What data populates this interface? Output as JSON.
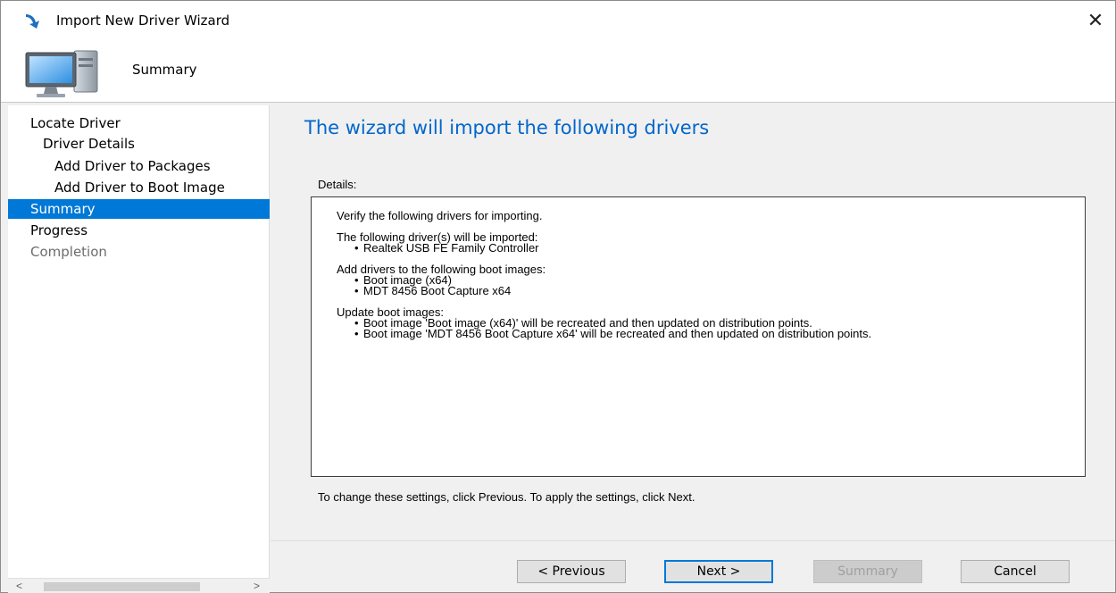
{
  "window": {
    "title": "Import New Driver Wizard",
    "close_glyph": "✕"
  },
  "header": {
    "title": "Summary",
    "icon": "computer-icon"
  },
  "nav": {
    "items": [
      {
        "label": "Locate Driver",
        "state": "normal"
      },
      {
        "label": "Driver Details",
        "state": "normal"
      },
      {
        "label": "Add Driver to Packages",
        "state": "normal"
      },
      {
        "label": "Add Driver to Boot Image",
        "state": "normal"
      },
      {
        "label": "Summary",
        "state": "selected"
      },
      {
        "label": "Progress",
        "state": "normal"
      },
      {
        "label": "Completion",
        "state": "disabled"
      }
    ],
    "scroll_left": "<",
    "scroll_right": ">"
  },
  "main": {
    "title": "The wizard will import the following drivers",
    "details_label": "Details:",
    "details": {
      "intro": "Verify the following drivers for importing.",
      "sections": [
        {
          "heading": "The following driver(s) will be imported:",
          "items": [
            "Realtek USB FE Family Controller"
          ]
        },
        {
          "heading": "Add drivers to the following boot images:",
          "items": [
            "Boot image (x64)",
            "MDT 8456 Boot Capture x64"
          ]
        },
        {
          "heading": "Update boot images:",
          "items": [
            "Boot image 'Boot image (x64)' will be recreated and then updated on distribution points.",
            "Boot image 'MDT 8456 Boot Capture x64' will be recreated and then updated on distribution points."
          ]
        }
      ]
    },
    "hint": "To change these settings, click Previous. To apply the settings, click Next."
  },
  "buttons": {
    "previous": "< Previous",
    "next": "Next >",
    "summary": "Summary",
    "cancel": "Cancel"
  },
  "colors": {
    "accent": "#0078d7",
    "title_blue": "#0066cc"
  }
}
